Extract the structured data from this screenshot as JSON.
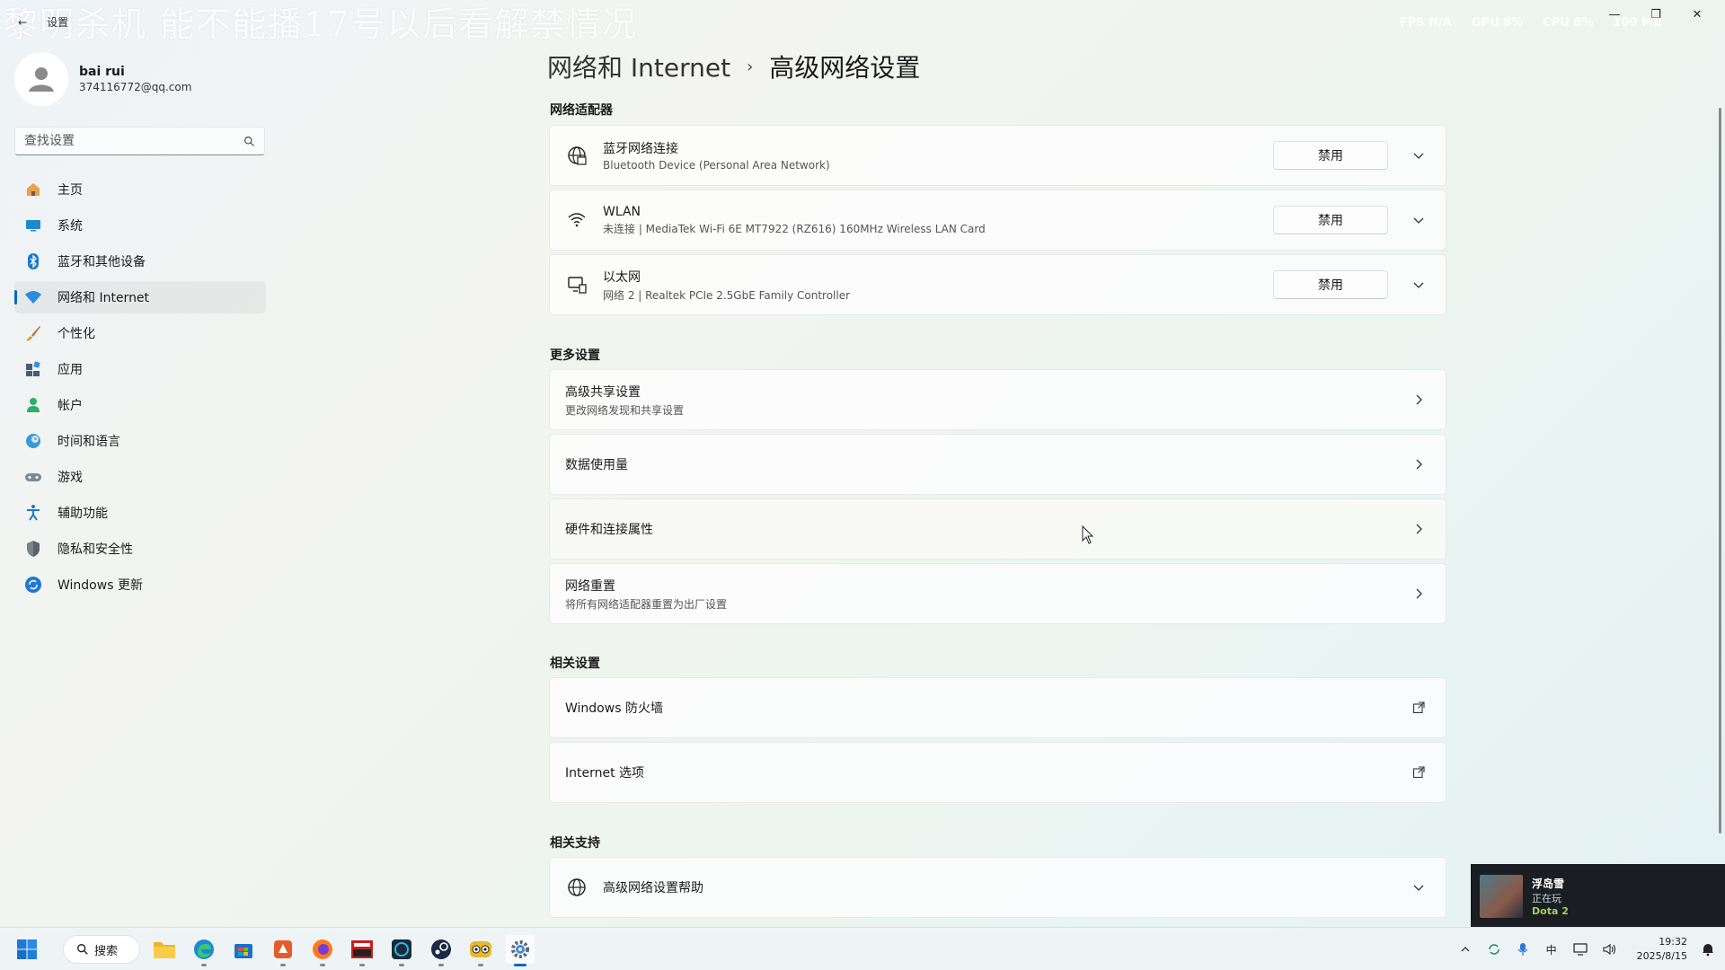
{
  "overlay": {
    "title": "黎明杀机 能不能播17号以后看解禁情况",
    "stats": [
      "FPS N/A",
      "GPU 8%",
      "CPU 8%",
      "100 MB"
    ]
  },
  "window": {
    "back_label": "←",
    "title": "设置",
    "minimize": "—",
    "maximize": "❐",
    "close": "✕"
  },
  "profile": {
    "name": "bai rui",
    "email": "374116772@qq.com"
  },
  "search": {
    "placeholder": "查找设置"
  },
  "nav": {
    "items": [
      {
        "label": "主页",
        "icon": "home-icon"
      },
      {
        "label": "系统",
        "icon": "system-icon"
      },
      {
        "label": "蓝牙和其他设备",
        "icon": "bluetooth-icon"
      },
      {
        "label": "网络和 Internet",
        "icon": "wifi-icon",
        "active": true
      },
      {
        "label": "个性化",
        "icon": "brush-icon"
      },
      {
        "label": "应用",
        "icon": "apps-icon"
      },
      {
        "label": "帐户",
        "icon": "account-icon"
      },
      {
        "label": "时间和语言",
        "icon": "globe-clock-icon"
      },
      {
        "label": "游戏",
        "icon": "gamepad-icon"
      },
      {
        "label": "辅助功能",
        "icon": "accessibility-icon"
      },
      {
        "label": "隐私和安全性",
        "icon": "shield-icon"
      },
      {
        "label": "Windows 更新",
        "icon": "update-icon"
      }
    ]
  },
  "breadcrumb": {
    "parent": "网络和 Internet",
    "separator": "›",
    "current": "高级网络设置"
  },
  "adapters": {
    "section_title": "网络适配器",
    "items": [
      {
        "title": "蓝牙网络连接",
        "subtitle": "Bluetooth Device (Personal Area Network)",
        "button": "禁用",
        "icon": "globe-network-icon"
      },
      {
        "title": "WLAN",
        "subtitle": "未连接 | MediaTek Wi-Fi 6E MT7922 (RZ616) 160MHz Wireless LAN Card",
        "button": "禁用",
        "icon": "wifi-icon"
      },
      {
        "title": "以太网",
        "subtitle": "网络 2 | Realtek PCIe 2.5GbE Family Controller",
        "button": "禁用",
        "icon": "ethernet-icon"
      }
    ]
  },
  "more": {
    "section_title": "更多设置",
    "items": [
      {
        "title": "高级共享设置",
        "subtitle": "更改网络发现和共享设置"
      },
      {
        "title": "数据使用量",
        "subtitle": ""
      },
      {
        "title": "硬件和连接属性",
        "subtitle": ""
      },
      {
        "title": "网络重置",
        "subtitle": "将所有网络适配器重置为出厂设置"
      }
    ]
  },
  "related": {
    "section_title": "相关设置",
    "items": [
      {
        "title": "Windows 防火墙"
      },
      {
        "title": "Internet 选项"
      }
    ]
  },
  "support": {
    "section_title": "相关支持",
    "items": [
      {
        "title": "高级网络设置帮助",
        "icon": "globe-icon"
      }
    ]
  },
  "game_notification": {
    "name": "浮岛雪",
    "status": "正在玩",
    "game": "Dota 2"
  },
  "taskbar": {
    "search_label": "搜索",
    "ime_label": "中",
    "time": "19:32",
    "date": "2025/8/15"
  },
  "colors": {
    "accent": "#0067c0"
  }
}
